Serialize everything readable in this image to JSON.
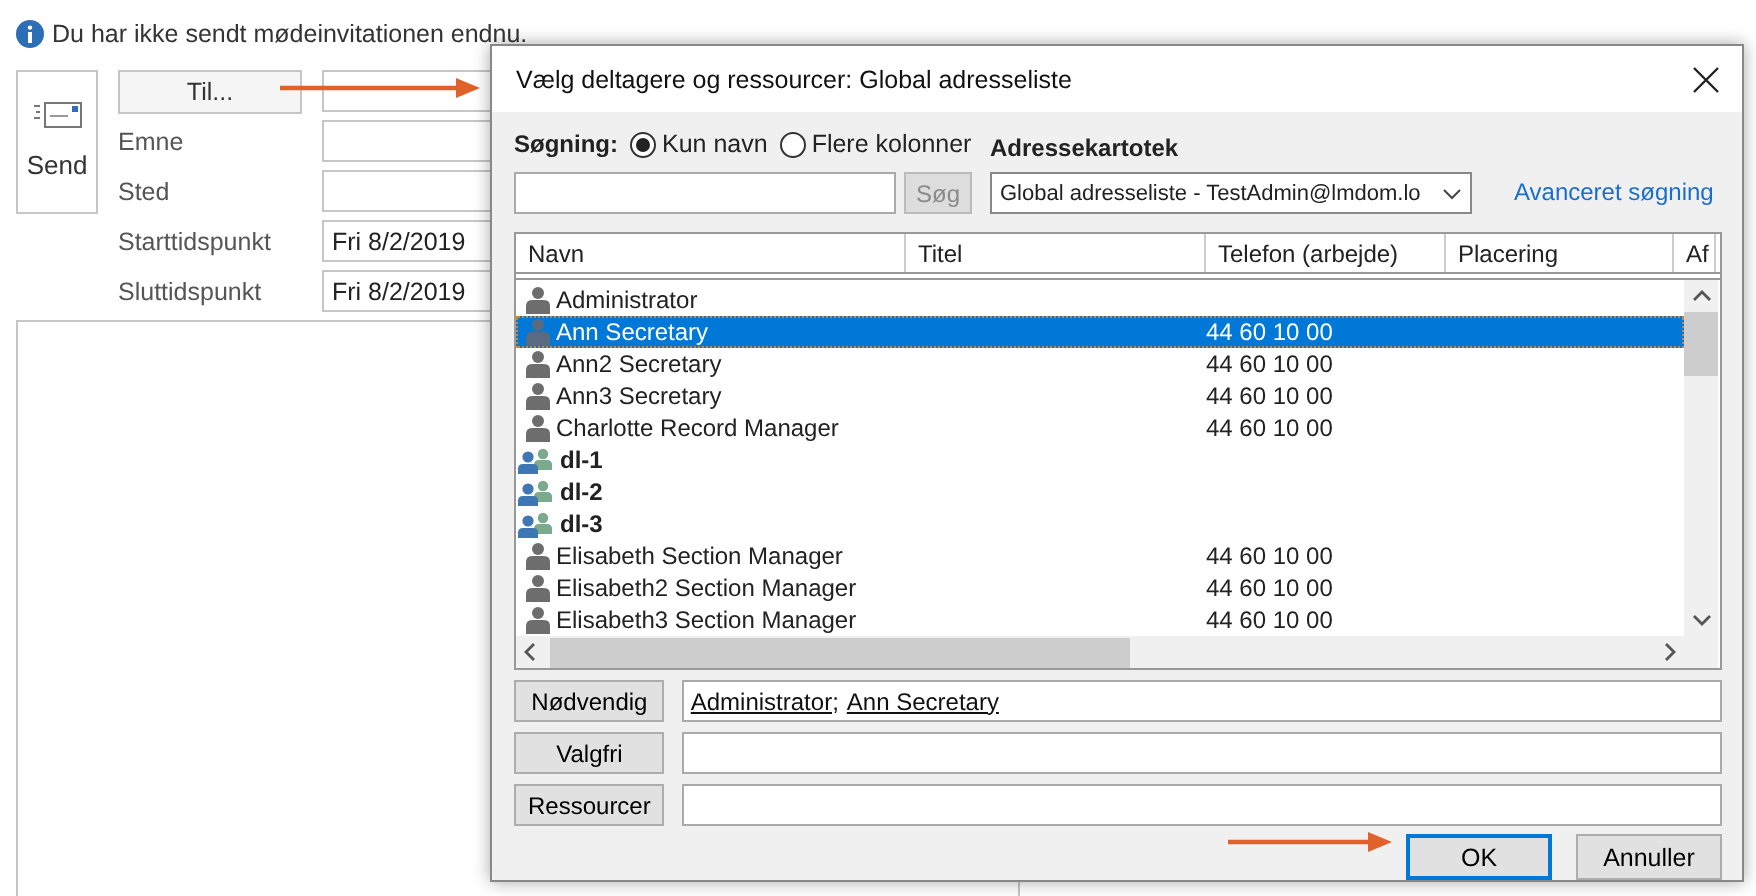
{
  "info_bar": {
    "text": "Du har ikke sendt mødeinvitationen endnu."
  },
  "compose": {
    "send_button": "Send",
    "to_button": "Til...",
    "fields": [
      {
        "label": "Emne"
      },
      {
        "label": "Sted"
      }
    ],
    "times": [
      {
        "label": "Starttidspunkt",
        "value": "Fri 8/2/2019"
      },
      {
        "label": "Sluttidspunkt",
        "value": "Fri 8/2/2019"
      }
    ]
  },
  "dialog": {
    "title": "Vælg deltagere og ressourcer: Global adresseliste",
    "search_label": "Søgning:",
    "search_options": [
      {
        "label": "Kun navn",
        "selected": true
      },
      {
        "label": "Flere kolonner",
        "selected": false
      }
    ],
    "search_button": {
      "label": "Søg",
      "disabled": true
    },
    "address_book_label": "Adressekartotek",
    "address_book": "Global adresseliste - TestAdmin@lmdom.lo",
    "advanced_link": "Avanceret søgning",
    "columns": [
      "Navn",
      "Titel",
      "Telefon (arbejde)",
      "Placering",
      "Af"
    ],
    "rows": [
      {
        "kind": "person",
        "name": "Administrator",
        "selected": false
      },
      {
        "kind": "person",
        "name": "Ann Secretary",
        "phone": "44 60 10 00",
        "selected": true
      },
      {
        "kind": "person",
        "name": "Ann2 Secretary",
        "phone": "44 60 10 00",
        "selected": false
      },
      {
        "kind": "person",
        "name": "Ann3 Secretary",
        "phone": "44 60 10 00",
        "selected": false
      },
      {
        "kind": "person",
        "name": "Charlotte Record Manager",
        "phone": "44 60 10 00",
        "selected": false
      },
      {
        "kind": "group",
        "name": "dl-1",
        "selected": false
      },
      {
        "kind": "group",
        "name": "dl-2",
        "selected": false
      },
      {
        "kind": "group",
        "name": "dl-3",
        "selected": false
      },
      {
        "kind": "person",
        "name": "Elisabeth Section Manager",
        "phone": "44 60 10 00",
        "selected": false
      },
      {
        "kind": "person",
        "name": "Elisabeth2 Section Manager",
        "phone": "44 60 10 00",
        "selected": false
      },
      {
        "kind": "person",
        "name": "Elisabeth3 Section Manager",
        "phone": "44 60 10 00",
        "selected": false
      }
    ],
    "recipients": [
      {
        "button": "Nødvendig",
        "names": [
          "Administrator;",
          "Ann Secretary"
        ]
      },
      {
        "button": "Valgfri"
      },
      {
        "button": "Ressourcer"
      }
    ],
    "buttons": [
      {
        "label": "OK",
        "default": true
      },
      {
        "label": "Annuller",
        "default": false
      }
    ]
  }
}
